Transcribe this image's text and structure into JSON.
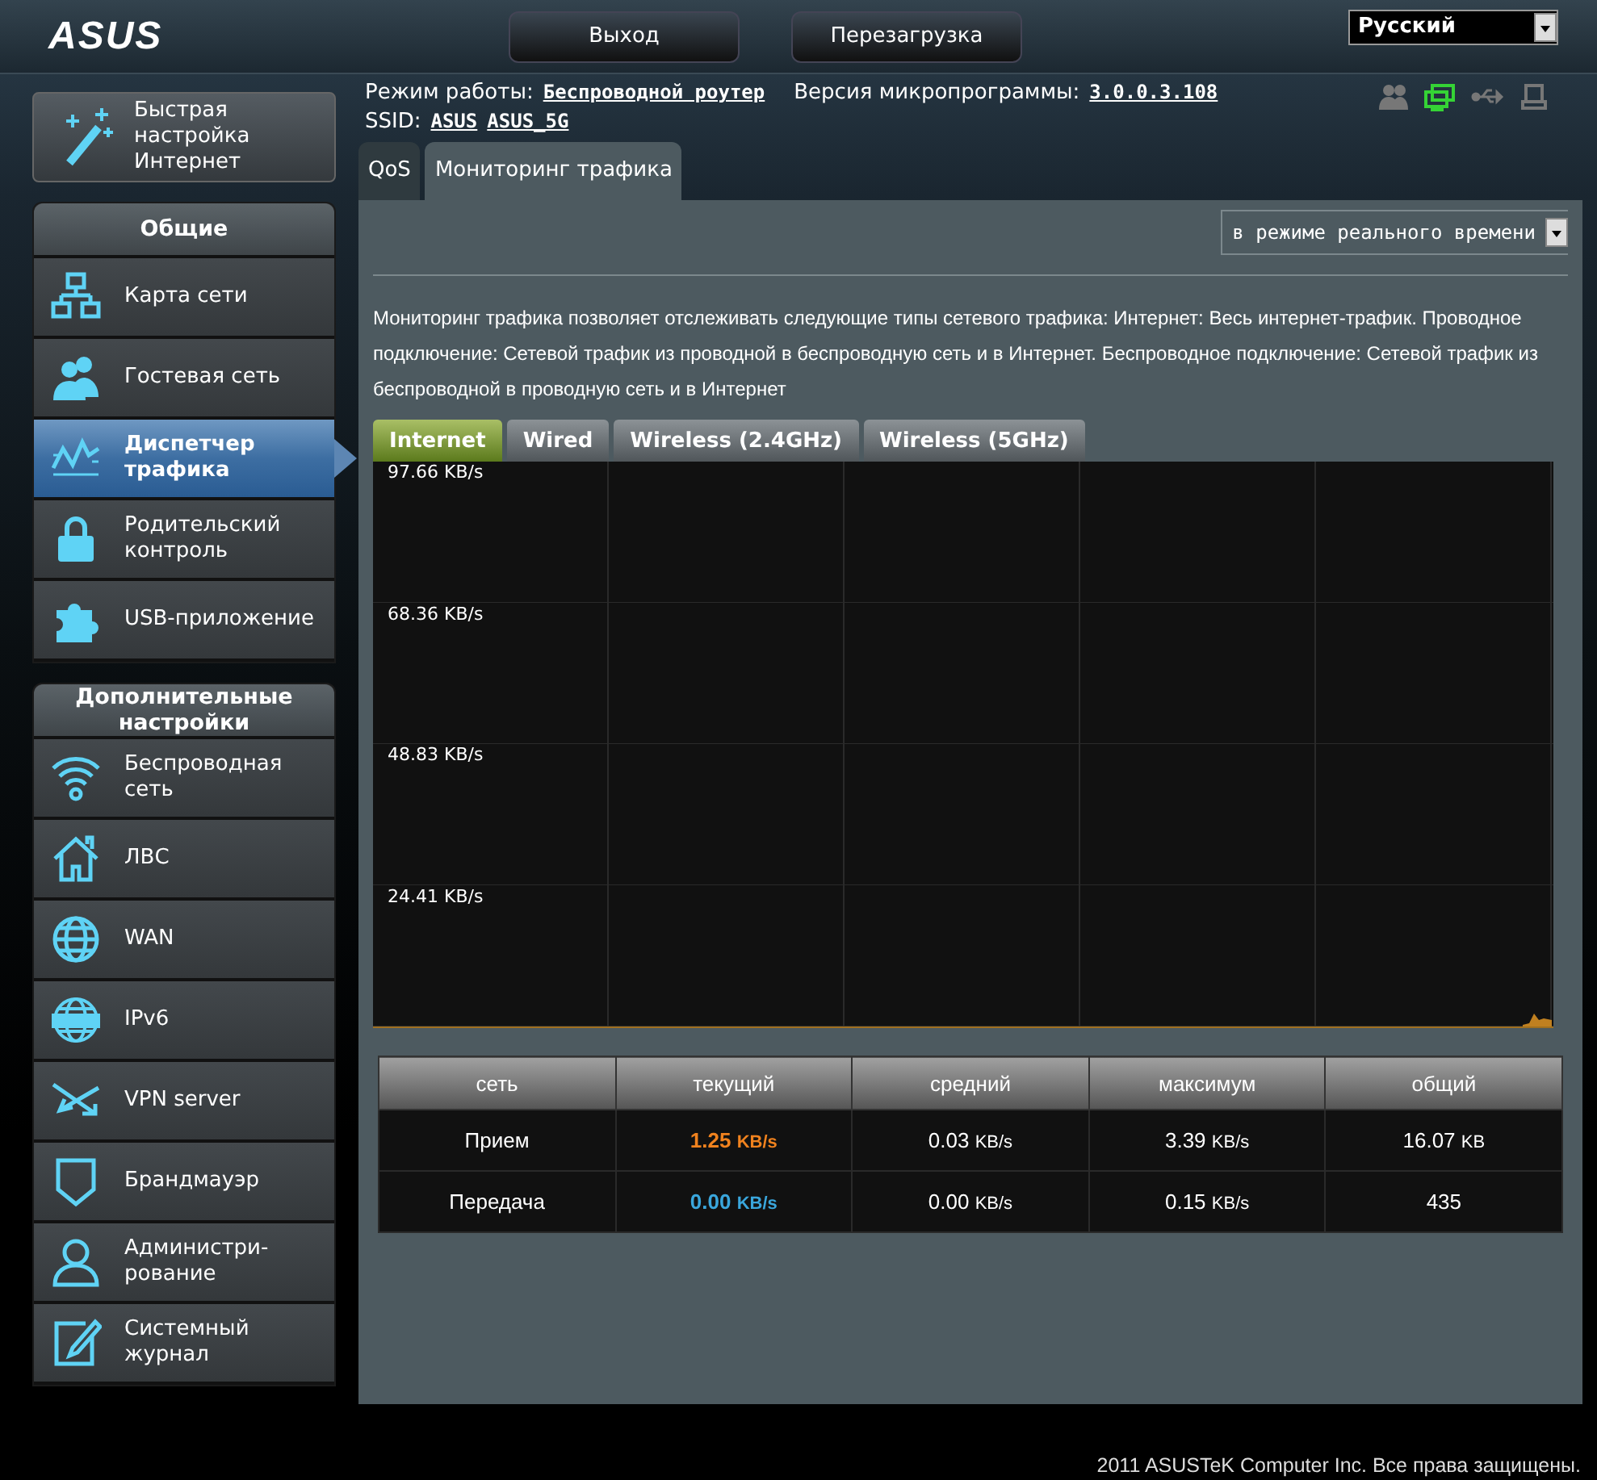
{
  "header": {
    "logo": "ASUS",
    "buttons": [
      "Выход",
      "Перезагрузка"
    ],
    "language": "Русский"
  },
  "info": {
    "mode_label": "Режим работы:",
    "mode_value": "Беспроводной роутер",
    "firmware_label": "Версия микропрограммы:",
    "firmware_value": "3.0.0.3.108",
    "ssid_label": "SSID:",
    "ssids": [
      "ASUS",
      "ASUS_5G"
    ]
  },
  "quick_setup": {
    "label": "Быстрая настройка Интернет"
  },
  "menu_sections": [
    {
      "title": "Общие",
      "items": [
        {
          "label": "Карта сети",
          "kind": "network",
          "selected": false
        },
        {
          "label": "Гостевая сеть",
          "kind": "guests",
          "selected": false
        },
        {
          "label": "Диспетчер трафика",
          "kind": "traffic",
          "selected": true
        },
        {
          "label": "Родительский контроль",
          "kind": "lock",
          "selected": false
        },
        {
          "label": "USB-приложение",
          "kind": "puzzle",
          "selected": false
        }
      ]
    },
    {
      "title": "Дополнительные настройки",
      "items": [
        {
          "label": "Беспроводная сеть",
          "kind": "wifi",
          "selected": false
        },
        {
          "label": "ЛВС",
          "kind": "house",
          "selected": false
        },
        {
          "label": "WAN",
          "kind": "globe",
          "selected": false
        },
        {
          "label": "IPv6",
          "kind": "globe6",
          "selected": false
        },
        {
          "label": "VPN server",
          "kind": "vpn",
          "selected": false
        },
        {
          "label": "Брандмауэр",
          "kind": "shield",
          "selected": false
        },
        {
          "label": "Администри-рование",
          "kind": "person",
          "selected": false
        },
        {
          "label": "Системный журнал",
          "kind": "log",
          "selected": false
        }
      ]
    }
  ],
  "page_tabs": [
    {
      "label": "QoS",
      "selected": false
    },
    {
      "label": "Мониторинг трафика",
      "selected": true
    }
  ],
  "view_select": "в режиме реального времени",
  "description": "Мониторинг трафика позволяет отслеживать следующие типы сетевого трафика: Интернет: Весь интернет-трафик. Проводное подключение: Сетевой трафик из проводной в беспроводную сеть и в Интернет. Беспроводное подключение: Сетевой трафик из беспроводной в проводную сеть и в Интернет",
  "traffic_tabs": [
    {
      "label": "Internet",
      "selected": true
    },
    {
      "label": "Wired",
      "selected": false
    },
    {
      "label": "Wireless (2.4GHz)",
      "selected": false
    },
    {
      "label": "Wireless (5GHz)",
      "selected": false
    }
  ],
  "graph": {
    "row_labels": [
      "97.66 KB/s",
      "68.36 KB/s",
      "48.83 KB/s",
      "24.41 KB/s"
    ]
  },
  "table": {
    "columns": [
      "сеть",
      "текущий",
      "средний",
      "максимум",
      "общий"
    ],
    "rows": [
      {
        "cells": [
          {
            "value": "Прием"
          },
          {
            "value": "1.25",
            "unit": "KB/s",
            "color": "#f0821e"
          },
          {
            "value": "0.03",
            "unit": "KB/s"
          },
          {
            "value": "3.39",
            "unit": "KB/s"
          },
          {
            "value": "16.07",
            "unit": "KB"
          }
        ]
      },
      {
        "cells": [
          {
            "value": "Передача"
          },
          {
            "value": "0.00",
            "unit": "KB/s",
            "color": "#3aa6dc"
          },
          {
            "value": "0.00",
            "unit": "KB/s"
          },
          {
            "value": "0.15",
            "unit": "KB/s"
          },
          {
            "value": "435"
          }
        ]
      }
    ]
  },
  "footer": "2011 ASUSTeK Computer Inc. Все права защищены."
}
